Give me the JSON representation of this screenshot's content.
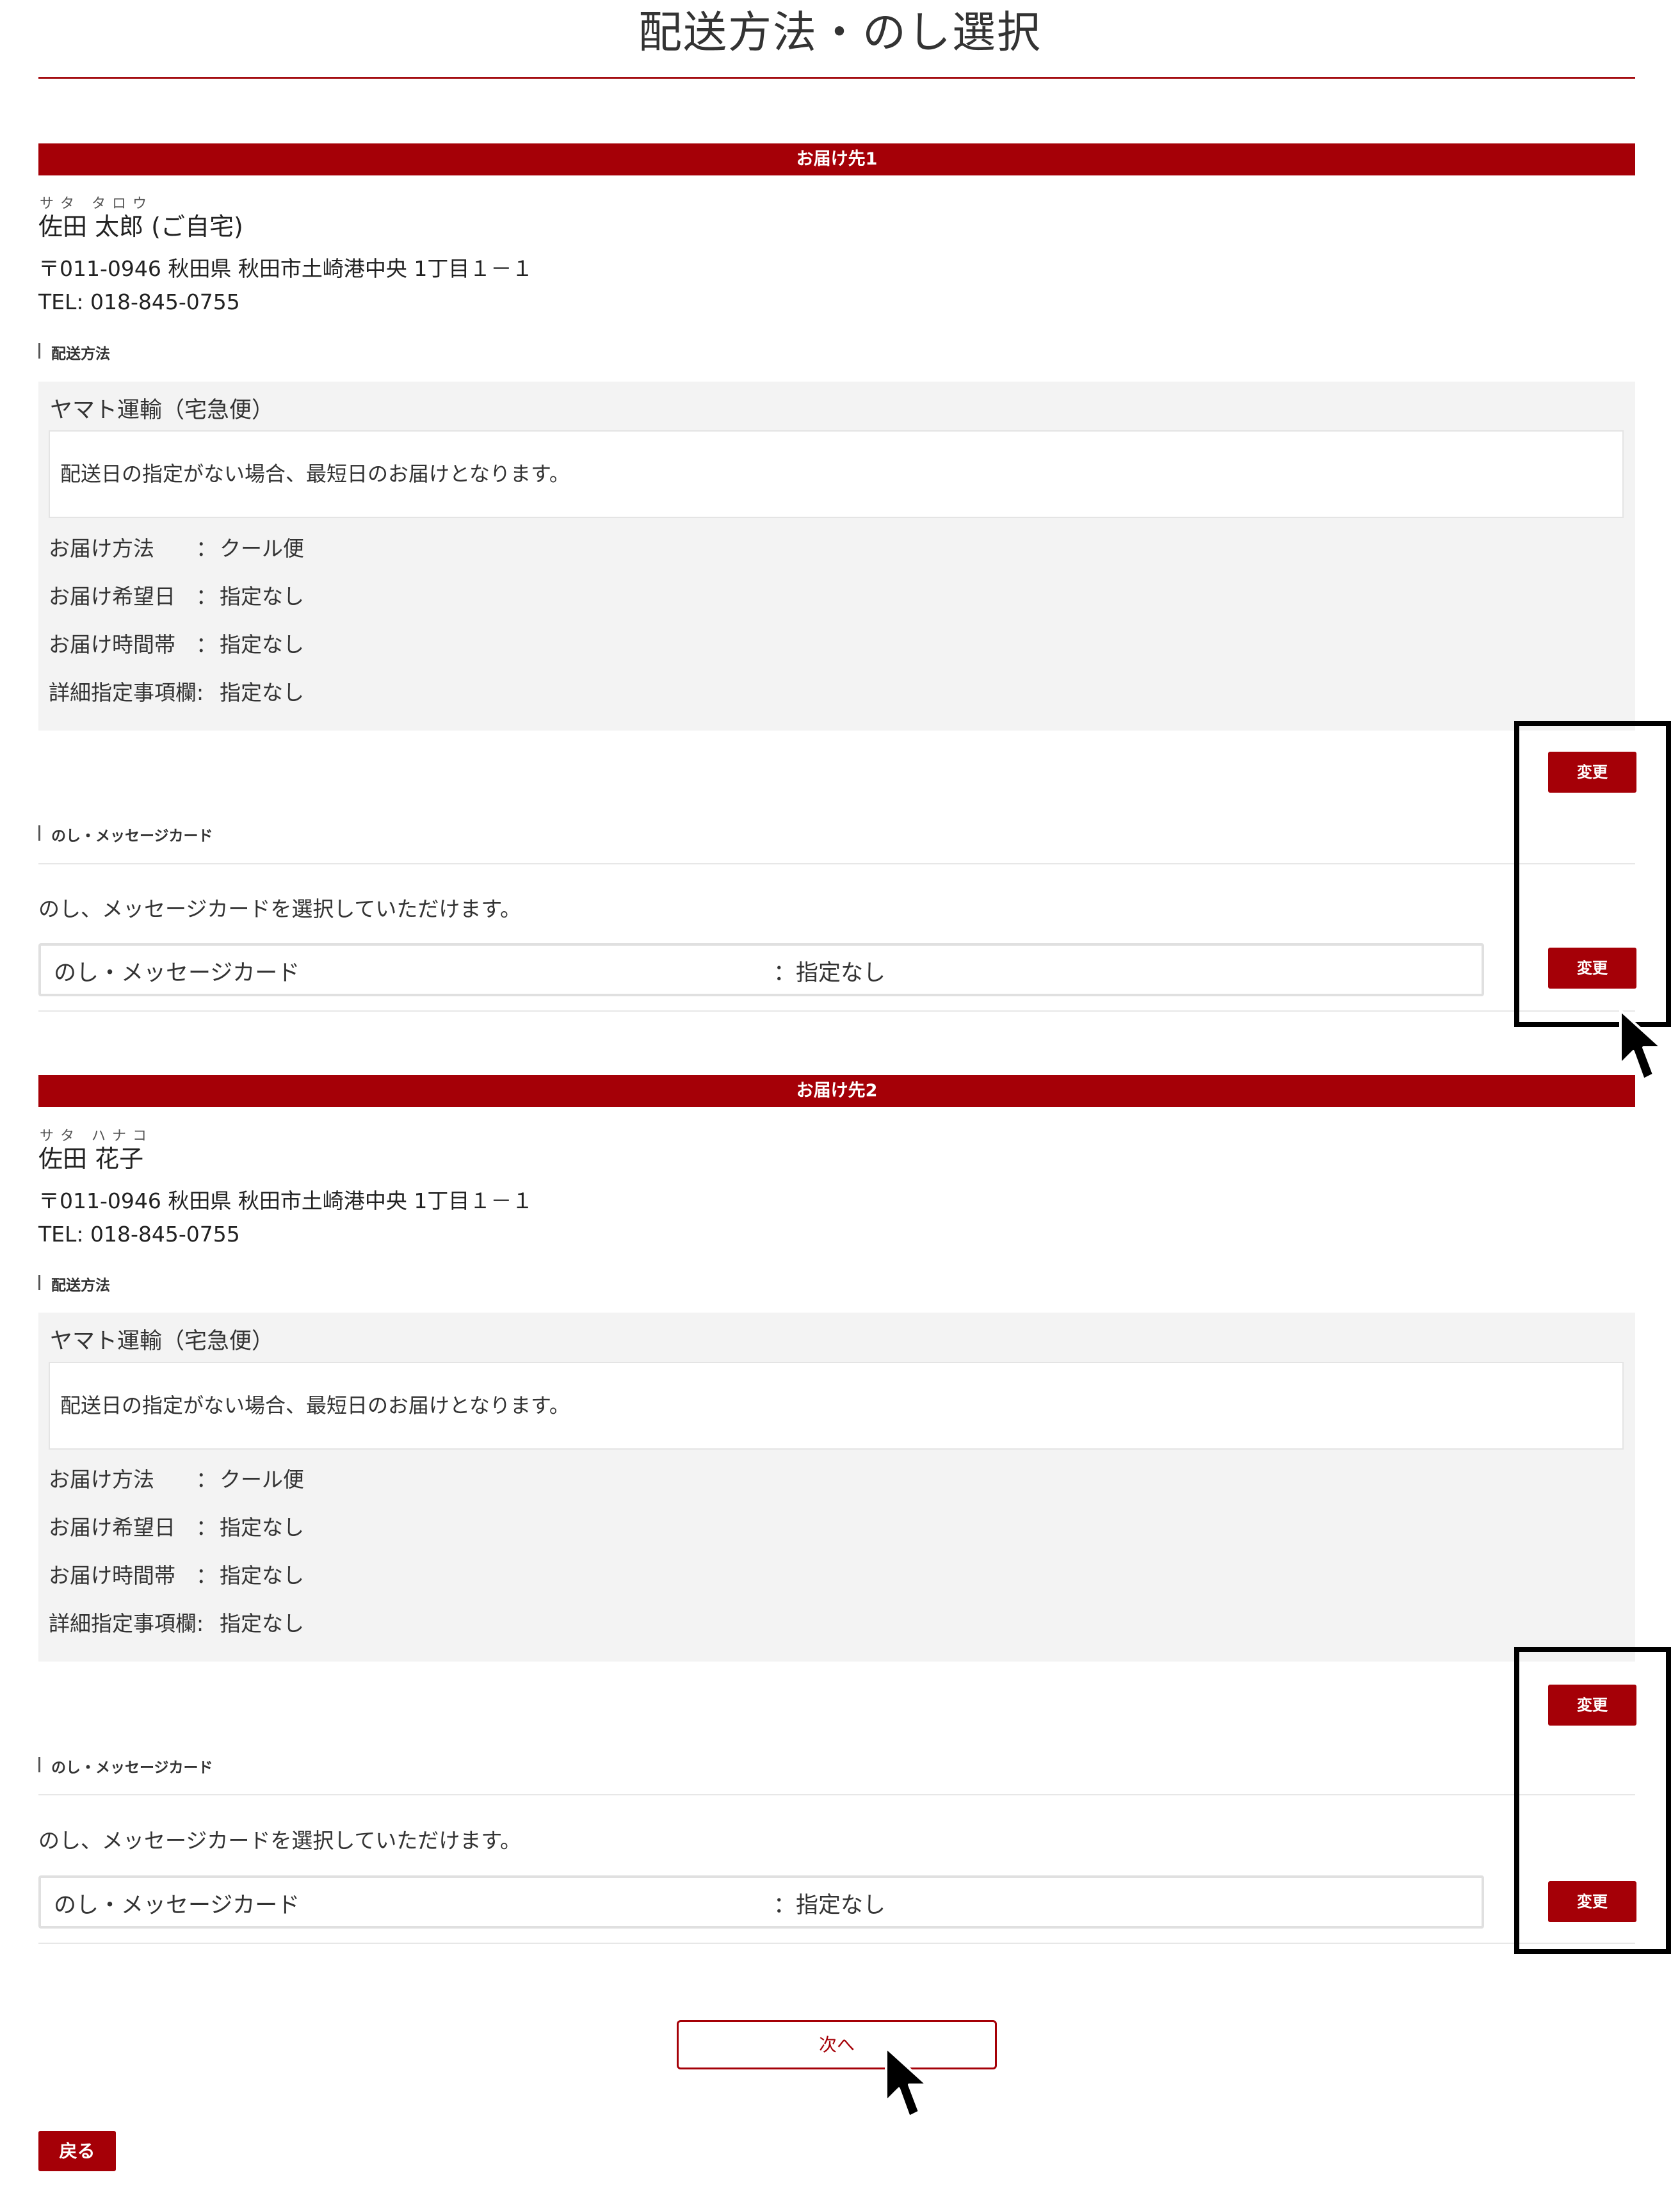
{
  "page_title": "配送方法・のし選択",
  "destinations": [
    {
      "header": "お届け先1",
      "ruby": "サタ タロウ",
      "name": "佐田 太郎 (ご自宅)",
      "address": "〒011-0946 秋田県 秋田市土崎港中央 1丁目１－１",
      "tel": "TEL: 018-845-0755",
      "shipping_label": "配送方法",
      "carrier": "ヤマト運輸（宅急便）",
      "note": "配送日の指定がない場合、最短日のお届けとなります。",
      "rows": [
        {
          "label": "お届け方法",
          "colon": "：",
          "value": "クール便"
        },
        {
          "label": "お届け希望日",
          "colon": "：",
          "value": "指定なし"
        },
        {
          "label": "お届け時間帯",
          "colon": "：",
          "value": "指定なし"
        },
        {
          "label": "詳細指定事項欄:",
          "colon": "",
          "value": "指定なし"
        }
      ],
      "change_shipping": "変更",
      "noshi_label": "のし・メッセージカード",
      "noshi_text": "のし、メッセージカードを選択していただけます。",
      "noshi_field_label": "のし・メッセージカード",
      "noshi_field_value": "：指定なし",
      "change_noshi": "変更"
    },
    {
      "header": "お届け先2",
      "ruby": "サタ ハナコ",
      "name": "佐田 花子",
      "address": "〒011-0946 秋田県 秋田市土崎港中央 1丁目１－１",
      "tel": "TEL: 018-845-0755",
      "shipping_label": "配送方法",
      "carrier": "ヤマト運輸（宅急便）",
      "note": "配送日の指定がない場合、最短日のお届けとなります。",
      "rows": [
        {
          "label": "お届け方法",
          "colon": "：",
          "value": "クール便"
        },
        {
          "label": "お届け希望日",
          "colon": "：",
          "value": "指定なし"
        },
        {
          "label": "お届け時間帯",
          "colon": "：",
          "value": "指定なし"
        },
        {
          "label": "詳細指定事項欄:",
          "colon": "",
          "value": "指定なし"
        }
      ],
      "change_shipping": "変更",
      "noshi_label": "のし・メッセージカード",
      "noshi_text": "のし、メッセージカードを選択していただけます。",
      "noshi_field_label": "のし・メッセージカード",
      "noshi_field_value": "：指定なし",
      "change_noshi": "変更"
    }
  ],
  "next_button": "次へ",
  "back_button": "戻る",
  "colors": {
    "accent": "#a50007",
    "panel": "#f3f3f3",
    "highlight": "#000000"
  },
  "icons": [
    "mouse-pointer-icon"
  ]
}
